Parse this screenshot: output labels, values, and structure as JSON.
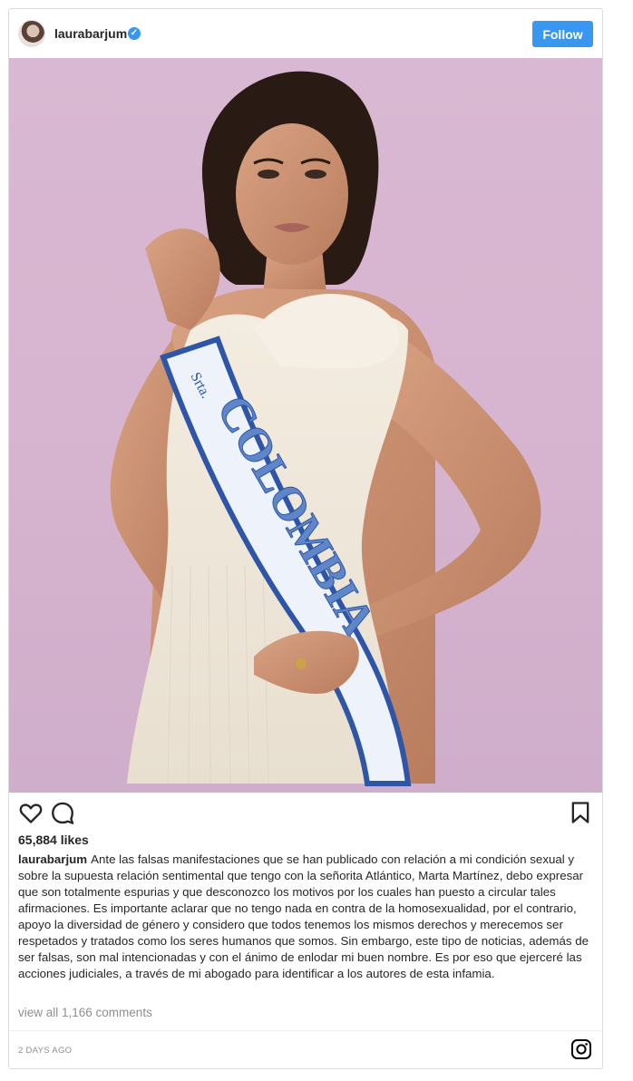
{
  "post": {
    "username": "laurabarjum",
    "verified_label": "✓",
    "follow_label": "Follow",
    "likes": "65,884 likes",
    "caption_user": "laurabarjum",
    "caption": "Ante las falsas manifestaciones que se han publicado con relación a mi condición sexual y sobre la supuesta relación sentimental que tengo con la señorita Atlántico, Marta Martínez, debo expresar que son totalmente espurias y que desconozco los motivos por los cuales han puesto a circular tales afirmaciones. Es importante aclarar que no tengo nada en contra de la homosexualidad, por el contrario, apoyo la diversidad de género y considero que todos tenemos los mismos derechos y merecemos ser respetados y tratados como los seres humanos que somos. Sin embargo, este tipo de noticias, además de ser falsas, son mal intencionadas y con el ánimo de enlodar mi buen nombre. Es por eso que ejerceré las acciones judiciales, a través de mi abogado para identificar a los autores de esta infamia.",
    "view_comments": "view all 1,166 comments",
    "date": "2 DAYS AGO",
    "sash_small": "Srta.",
    "sash_text": "COLOMBIA"
  },
  "icons": {
    "like": "heart-icon",
    "comment": "comment-icon",
    "save": "bookmark-icon",
    "brand": "instagram-icon"
  },
  "colors": {
    "accent": "#3897f0",
    "background_photo": "#d7b4cf",
    "sash_blue": "#2f56a6"
  }
}
